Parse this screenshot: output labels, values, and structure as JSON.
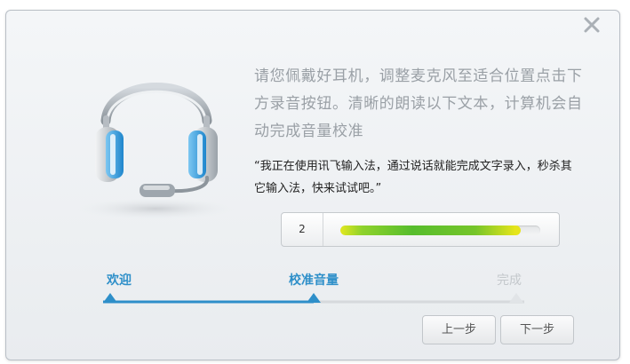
{
  "dialog": {
    "instruction": "请您佩戴好耳机，调整麦克风至适合位置点击下方录音按钮。清晰的朗读以下文本，计算机会自动完成音量校准",
    "reading_text": "“我正在使用讯飞输入法，通过说话就能完成文字录入，秒杀其它输入法，快来试试吧。”",
    "close_icon": "close-icon",
    "headset_icon": "headset-icon"
  },
  "meter": {
    "value": "2",
    "level_fraction": 0.9
  },
  "steps": [
    {
      "label": "欢迎",
      "state": "done"
    },
    {
      "label": "校准音量",
      "state": "current"
    },
    {
      "label": "完成",
      "state": "pending"
    }
  ],
  "step_progress_fraction": 0.5,
  "buttons": {
    "prev": "上一步",
    "next": "下一步"
  },
  "colors": {
    "accent": "#2e8fc9",
    "inactive": "#c4c8cc"
  }
}
